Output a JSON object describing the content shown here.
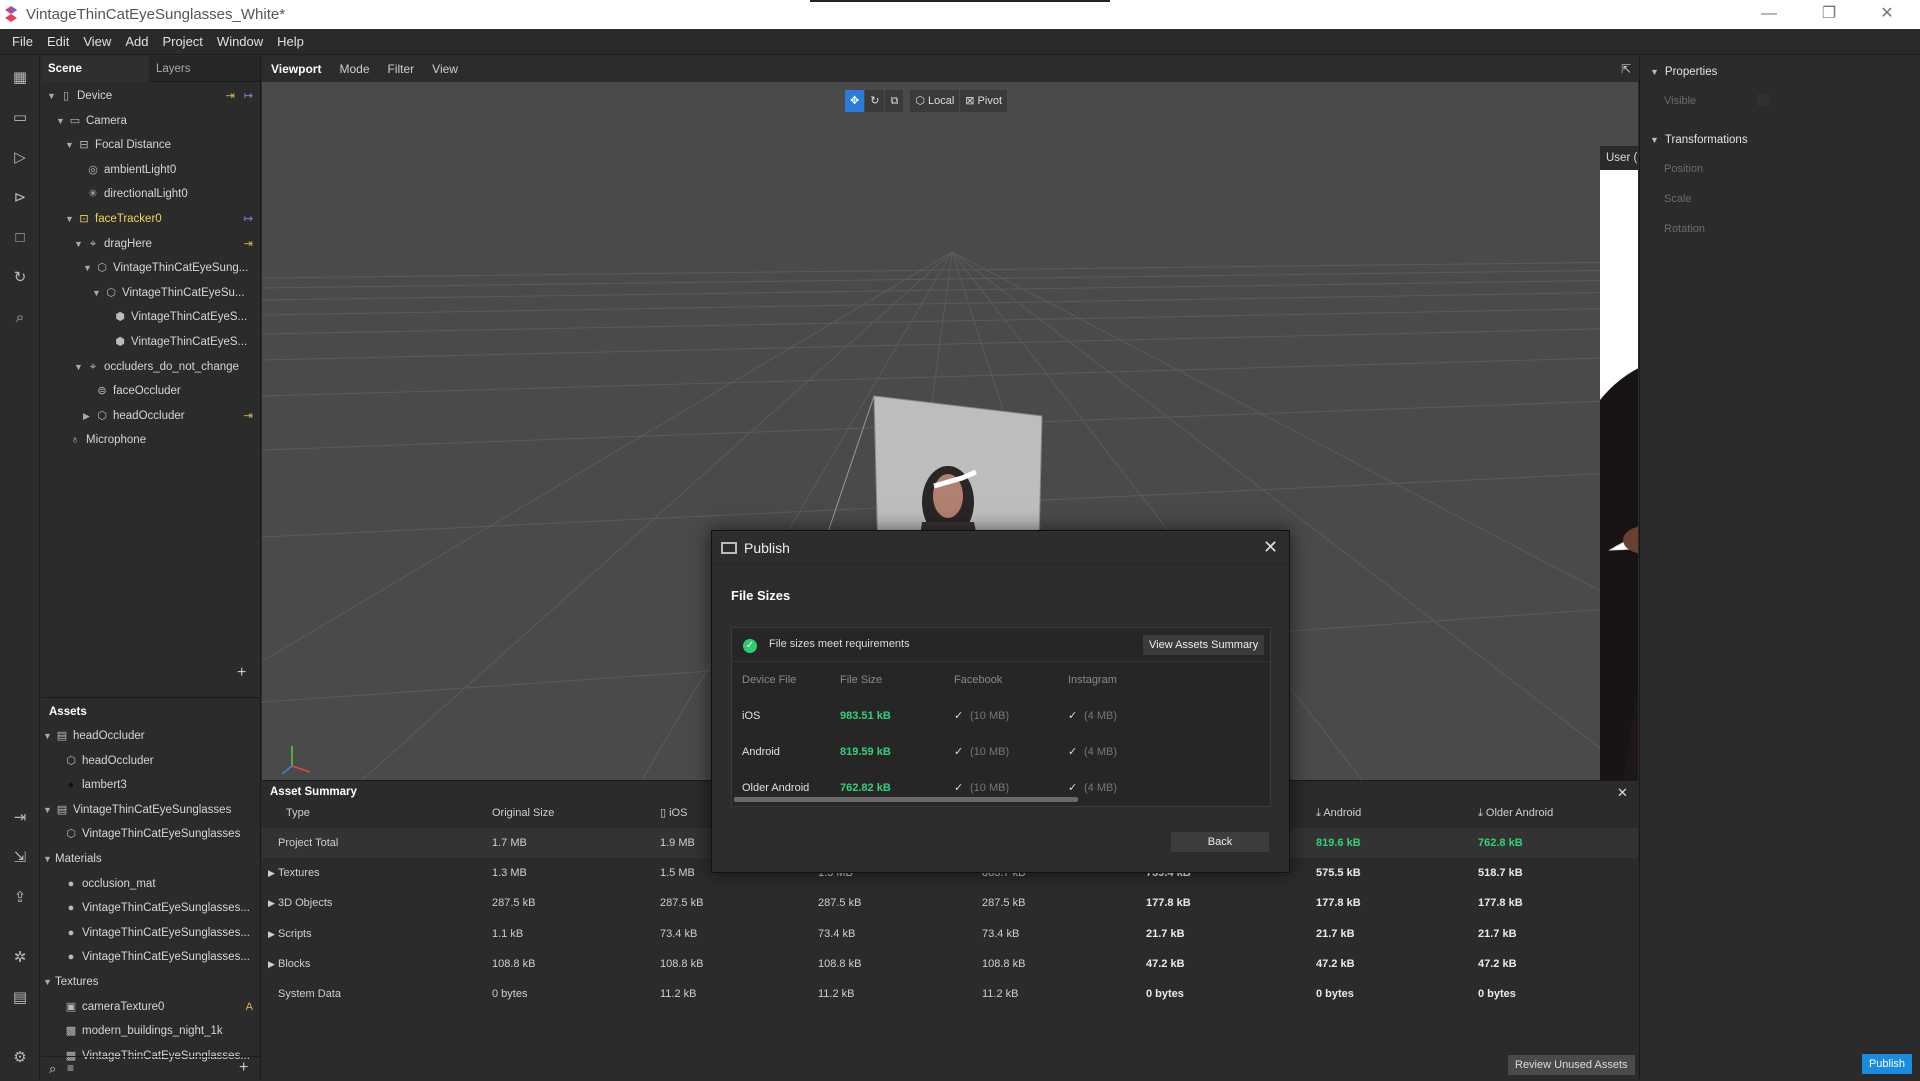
{
  "app": {
    "title": "VintageThinCatEyeSunglasses_White*",
    "window_controls": [
      "—",
      "❐",
      "✕"
    ]
  },
  "menu": [
    "File",
    "Edit",
    "View",
    "Add",
    "Project",
    "Window",
    "Help"
  ],
  "scene_panel": {
    "tabs": [
      "Scene",
      "Layers"
    ],
    "tree": [
      {
        "label": "Device",
        "depth": 0,
        "arrow": "▼",
        "icon": "device-icon"
      },
      {
        "label": "Camera",
        "depth": 1,
        "arrow": "▼",
        "icon": "camera-icon"
      },
      {
        "label": "Focal Distance",
        "depth": 2,
        "arrow": "▼",
        "icon": "focal-distance-icon"
      },
      {
        "label": "ambientLight0",
        "depth": 3,
        "arrow": "",
        "icon": "ambient-light-icon"
      },
      {
        "label": "directionalLight0",
        "depth": 3,
        "arrow": "",
        "icon": "directional-light-icon"
      },
      {
        "label": "faceTracker0",
        "depth": 2,
        "arrow": "▼",
        "icon": "face-tracker-icon"
      },
      {
        "label": "dragHere",
        "depth": 3,
        "arrow": "▼",
        "icon": "null-object-icon"
      },
      {
        "label": "VintageThinCatEyeSung...",
        "depth": 4,
        "arrow": "▼",
        "icon": "3d-object-icon"
      },
      {
        "label": "VintageThinCatEyeSu...",
        "depth": 5,
        "arrow": "▼",
        "icon": "3d-object-icon"
      },
      {
        "label": "VintageThinCatEyeS...",
        "depth": 6,
        "arrow": "",
        "icon": "mesh-icon"
      },
      {
        "label": "VintageThinCatEyeS...",
        "depth": 6,
        "arrow": "",
        "icon": "mesh-icon"
      },
      {
        "label": "occluders_do_not_change",
        "depth": 3,
        "arrow": "▼",
        "icon": "null-object-icon"
      },
      {
        "label": "faceOccluder",
        "depth": 4,
        "arrow": "",
        "icon": "face-mesh-icon"
      },
      {
        "label": "headOccluder",
        "depth": 4,
        "arrow": "▶",
        "icon": "3d-object-icon"
      },
      {
        "label": "Microphone",
        "depth": 1,
        "arrow": "",
        "icon": "microphone-icon"
      }
    ]
  },
  "assets_panel": {
    "title": "Assets",
    "tree": [
      {
        "label": "headOccluder",
        "depth": 0,
        "arrow": "▼",
        "icon": "file-icon"
      },
      {
        "label": "headOccluder",
        "depth": 1,
        "arrow": "",
        "icon": "3d-object-icon"
      },
      {
        "label": "lambert3",
        "depth": 1,
        "arrow": "",
        "icon": "material-dark-icon"
      },
      {
        "label": "VintageThinCatEyeSunglasses",
        "depth": 0,
        "arrow": "▼",
        "icon": "file-icon"
      },
      {
        "label": "VintageThinCatEyeSunglasses",
        "depth": 1,
        "arrow": "",
        "icon": "3d-object-icon"
      },
      {
        "label": "Materials",
        "depth": 0,
        "arrow": "▼",
        "icon": ""
      },
      {
        "label": "occlusion_mat",
        "depth": 1,
        "arrow": "",
        "icon": "material-icon"
      },
      {
        "label": "VintageThinCatEyeSunglasses...",
        "depth": 1,
        "arrow": "",
        "icon": "material-icon"
      },
      {
        "label": "VintageThinCatEyeSunglasses...",
        "depth": 1,
        "arrow": "",
        "icon": "material-icon"
      },
      {
        "label": "VintageThinCatEyeSunglasses...",
        "depth": 1,
        "arrow": "",
        "icon": "material-icon"
      },
      {
        "label": "Textures",
        "depth": 0,
        "arrow": "▼",
        "icon": ""
      },
      {
        "label": "cameraTexture0",
        "depth": 1,
        "arrow": "",
        "icon": "texture-icon",
        "badge": "A"
      },
      {
        "label": "modern_buildings_night_1k",
        "depth": 1,
        "arrow": "",
        "icon": "image-icon"
      },
      {
        "label": "VintageThinCatEyeSunglasses...",
        "depth": 1,
        "arrow": "",
        "icon": "image-icon"
      }
    ]
  },
  "viewport": {
    "tabs": [
      "Viewport",
      "Mode",
      "Filter",
      "View"
    ],
    "tools": {
      "local": "Local",
      "pivot": "Pivot"
    },
    "preview_device": "User (Sharing)"
  },
  "properties": {
    "sections": [
      "Properties",
      "Transformations"
    ],
    "visible_label": "Visible",
    "rows": [
      "Position",
      "Scale",
      "Rotation"
    ]
  },
  "asset_summary": {
    "title": "Asset Summary",
    "columns": [
      "Type",
      "Original Size",
      "iOS",
      "Android",
      "Older Android"
    ],
    "rows": [
      {
        "type": "Project Total",
        "expandable": false,
        "c": [
          "1.7 MB",
          "1.9 MB",
          "",
          "",
          "",
          "819.6 kB",
          "762.8 kB"
        ]
      },
      {
        "type": "Textures",
        "expandable": true,
        "c": [
          "1.3 MB",
          "1.5 MB",
          "1.3 MB",
          "863.7 kB",
          "739.4 kB",
          "575.5 kB",
          "518.7 kB"
        ]
      },
      {
        "type": "3D Objects",
        "expandable": true,
        "c": [
          "287.5 kB",
          "287.5 kB",
          "287.5 kB",
          "287.5 kB",
          "177.8 kB",
          "177.8 kB",
          "177.8 kB"
        ]
      },
      {
        "type": "Scripts",
        "expandable": true,
        "c": [
          "1.1 kB",
          "73.4 kB",
          "73.4 kB",
          "73.4 kB",
          "21.7 kB",
          "21.7 kB",
          "21.7 kB"
        ]
      },
      {
        "type": "Blocks",
        "expandable": true,
        "c": [
          "108.8 kB",
          "108.8 kB",
          "108.8 kB",
          "108.8 kB",
          "47.2 kB",
          "47.2 kB",
          "47.2 kB"
        ]
      },
      {
        "type": "System Data",
        "expandable": false,
        "c": [
          "0 bytes",
          "11.2 kB",
          "11.2 kB",
          "11.2 kB",
          "0 bytes",
          "0 bytes",
          "0 bytes"
        ]
      }
    ],
    "review_button": "Review Unused Assets",
    "publish_button": "Publish"
  },
  "publish_dialog": {
    "title": "Publish",
    "subtitle": "File Sizes",
    "status": "File sizes meet requirements",
    "view_summary": "View Assets Summary",
    "headers": [
      "Device File",
      "File Size",
      "Facebook",
      "Instagram"
    ],
    "rows": [
      {
        "device": "iOS",
        "size": "983.51 kB",
        "fb": "(10 MB)",
        "ig": "(4 MB)"
      },
      {
        "device": "Android",
        "size": "819.59 kB",
        "fb": "(10 MB)",
        "ig": "(4 MB)"
      },
      {
        "device": "Older Android",
        "size": "762.82 kB",
        "fb": "(10 MB)",
        "ig": "(4 MB)"
      }
    ],
    "back_button": "Back"
  }
}
